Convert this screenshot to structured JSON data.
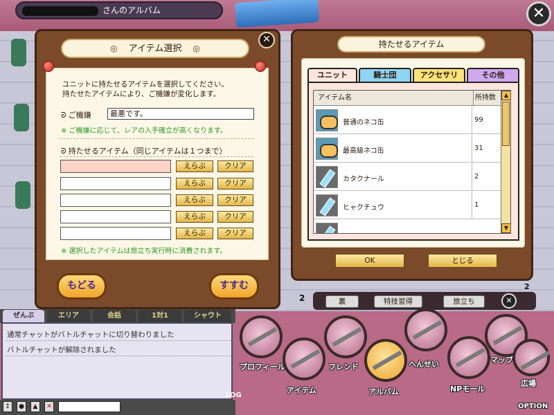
{
  "header": {
    "album_title": "さんのアルバム",
    "close": "✕"
  },
  "item_select": {
    "title": "アイテム選択",
    "close": "✕",
    "description_1": "ユニットに持たせるアイテムを選択してください。",
    "description_2": "持たせたアイテムにより、ご機嫌が変化します。",
    "mood_label": "ご機嫌",
    "mood_value": "最悪です。",
    "mood_note": "※ ご機嫌に応じて、レアの入手確立が高くなります。",
    "items_label": "持たせるアイテム（同じアイテムは１つまで）",
    "choose_label": "えらぶ",
    "clear_label": "クリア",
    "consume_note": "※ 選択したアイテムは旅立ち実行時に消費されます。",
    "back_button": "もどる",
    "next_button": "すすむ"
  },
  "holdable_items": {
    "title": "持たせるアイテム",
    "tabs": [
      "ユニット",
      "騎士団",
      "アクセサリ",
      "その他"
    ],
    "columns": {
      "name": "アイテム名",
      "count": "所持数"
    },
    "rows": [
      {
        "icon": "cat-can-icon",
        "name": "普通のネコ缶",
        "count": "99"
      },
      {
        "icon": "cat-can-icon",
        "name": "最高級ネコ缶",
        "count": "31"
      },
      {
        "icon": "potion-bottle-icon",
        "name": "カタクナール",
        "count": "2"
      },
      {
        "icon": "potion-bottle-icon",
        "name": "ヒャクチュウ",
        "count": "1"
      }
    ],
    "ok_button": "OK",
    "close_button": "とじる"
  },
  "album_actions": {
    "back_page": "裏",
    "skill_learn": "特技習得",
    "depart": "旅立ち",
    "page_left": "2",
    "page_right": "2"
  },
  "chat": {
    "tabs": [
      "ぜんぶ",
      "エリア",
      "会話",
      "1対1",
      "シャウト"
    ],
    "messages": [
      "通常チャットがバトルチャットに切り替わりました",
      "バトルチャットが解除されました"
    ],
    "log_label": "LOG"
  },
  "menu": {
    "items": [
      "プロフィール",
      "アイテム",
      "フレンド",
      "アルバム",
      "へんせい",
      "NPモール",
      "マップ",
      "広場"
    ],
    "option": "OPTION"
  },
  "colors": {
    "wood": "#7b4a2a",
    "paper": "#fcf7e6",
    "button": "#e2b64a",
    "note_green": "#2d9a2a"
  }
}
